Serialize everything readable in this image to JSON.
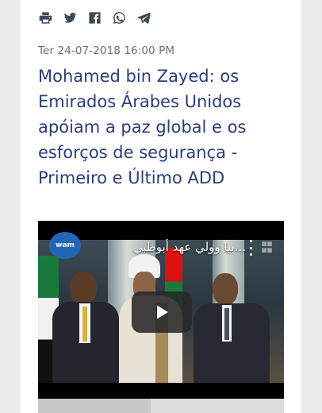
{
  "share": {
    "icons": [
      "print-icon",
      "twitter-icon",
      "facebook-icon",
      "whatsapp-icon",
      "telegram-icon"
    ]
  },
  "article": {
    "date": "Ter 24-07-2018 16:00 PM",
    "headline": "Mohamed bin Zayed: os Emirados Árabes Unidos apóiam a paz global e os esforços de segurança - Primeiro e Último ADD"
  },
  "video": {
    "title": "...بيا وولي عهد أبوظبي",
    "channel_logo": "wam"
  },
  "colors": {
    "headline": "#2a3e79",
    "date": "#6e6e6e",
    "icons": "#3d4a59",
    "page_background": "#ebebeb"
  }
}
